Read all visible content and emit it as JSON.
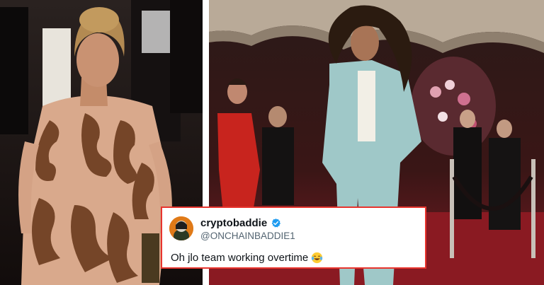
{
  "tweet": {
    "display_name": "cryptobaddie",
    "handle": "@ONCHAINBADDIE1",
    "text": "Oh jlo team working overtime",
    "emoji": "😂"
  },
  "icons": {
    "verified": "verified-badge-icon",
    "emoji": "laughing-tears-emoji"
  },
  "colors": {
    "tweet_border": "#e8342e",
    "verified_blue": "#1d9bf0",
    "carpet_red": "#8a1a22"
  }
}
